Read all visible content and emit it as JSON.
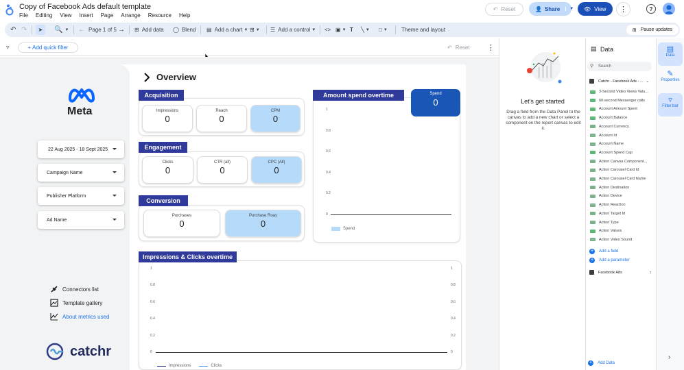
{
  "app": {
    "title": "Copy of Facebook Ads default template",
    "menu": [
      "File",
      "Editing",
      "View",
      "Insert",
      "Page",
      "Arrange",
      "Resource",
      "Help"
    ],
    "reset_label": "Reset",
    "share_label": "Share",
    "view_label": "View"
  },
  "toolbar": {
    "page_indicator": "Page 1 of 5",
    "add_data": "Add data",
    "blend": "Blend",
    "add_chart": "Add a chart",
    "add_control": "Add a control",
    "theme_layout": "Theme and layout",
    "pause_updates": "Pause updates"
  },
  "filterbar": {
    "quick_filter": "+ Add quick filter",
    "reset": "Reset"
  },
  "report": {
    "brand": "Meta",
    "filters": {
      "date_range": "22 Aug 2025 - 18 Sept 2025",
      "campaign": "Campaign Name",
      "platform": "Publisher Platform",
      "ad_name": "Ad Name"
    },
    "links": {
      "connectors": "Connectors list",
      "template_gallery": "Template gallery",
      "about_metrics": "About metrics used"
    },
    "catchr": "catchr",
    "overview_title": "Overview",
    "acquisition": {
      "title": "Acquisition",
      "impressions_label": "Impressions",
      "impressions_value": "0",
      "reach_label": "Reach",
      "reach_value": "0",
      "cpm_label": "CPM",
      "cpm_value": "0"
    },
    "engagement": {
      "title": "Engagement",
      "clicks_label": "Clicks",
      "clicks_value": "0",
      "ctr_label": "CTR (all)",
      "ctr_value": "0",
      "cpc_label": "CPC (All)",
      "cpc_value": "0"
    },
    "conversion": {
      "title": "Conversion",
      "purchases_label": "Purchases",
      "purchases_value": "0",
      "roas_label": "Purchase Roas",
      "roas_value": "0"
    },
    "spend_card": {
      "label": "Spend",
      "value": "0"
    },
    "colors": {
      "section_header": "#303a9b",
      "kpi_highlight": "#b6dafa",
      "spend_card": "#1a56b5"
    }
  },
  "chart_data": [
    {
      "type": "line",
      "title": "Amount spend overtime",
      "y_ticks": [
        "1",
        "0.8",
        "0.6",
        "0.4",
        "0.2",
        "0"
      ],
      "ylim": [
        0,
        1
      ],
      "series": [
        {
          "name": "Spend",
          "values": []
        }
      ],
      "legend": "bottom-left"
    },
    {
      "type": "line",
      "title": "Impressions & Clicks overtime",
      "y_ticks": [
        "1",
        "0.8",
        "0.6",
        "0.4",
        "0.2",
        "0"
      ],
      "y2_ticks": [
        "1",
        "0.8",
        "0.6",
        "0.4",
        "0.2",
        "0"
      ],
      "ylim": [
        0,
        1
      ],
      "series": [
        {
          "name": "Impressions",
          "values": []
        },
        {
          "name": "Clicks",
          "values": []
        }
      ],
      "legend": "bottom-left"
    }
  ],
  "get_started": {
    "title": "Let's get started",
    "body": "Drag a field from the Data Panel to the canvas to add a new chart or select a component on the report canvas to edit it."
  },
  "data_panel": {
    "title": "Data",
    "search_placeholder": "Search",
    "source": "Catchr - Facebook Ads - ...",
    "fields": [
      {
        "name": "3-Second Video Views Valu...",
        "kind": "num"
      },
      {
        "name": "60-second Messenger calls",
        "kind": "num"
      },
      {
        "name": "Account Amount Spent",
        "kind": "num"
      },
      {
        "name": "Account Balance",
        "kind": "num"
      },
      {
        "name": "Account Currency",
        "kind": "txt"
      },
      {
        "name": "Account Id",
        "kind": "txt"
      },
      {
        "name": "Account Name",
        "kind": "txt"
      },
      {
        "name": "Account Spend Cap",
        "kind": "num"
      },
      {
        "name": "Action Canvas Component...",
        "kind": "txt"
      },
      {
        "name": "Action Carousel Card Id",
        "kind": "txt"
      },
      {
        "name": "Action Carousel Card Name",
        "kind": "txt"
      },
      {
        "name": "Action Destination",
        "kind": "txt"
      },
      {
        "name": "Action Device",
        "kind": "txt"
      },
      {
        "name": "Action Reaction",
        "kind": "txt"
      },
      {
        "name": "Action Target Id",
        "kind": "txt"
      },
      {
        "name": "Action Type",
        "kind": "txt"
      },
      {
        "name": "Action Values",
        "kind": "num"
      },
      {
        "name": "Action Video Sound",
        "kind": "txt"
      }
    ],
    "add_field": "Add a field",
    "add_parameter": "Add a parameter",
    "source2": "Facebook Ads",
    "add_data": "Add Data"
  },
  "side_tabs": {
    "data": "Data",
    "properties": "Properties",
    "filter_bar": "Filter bar"
  }
}
